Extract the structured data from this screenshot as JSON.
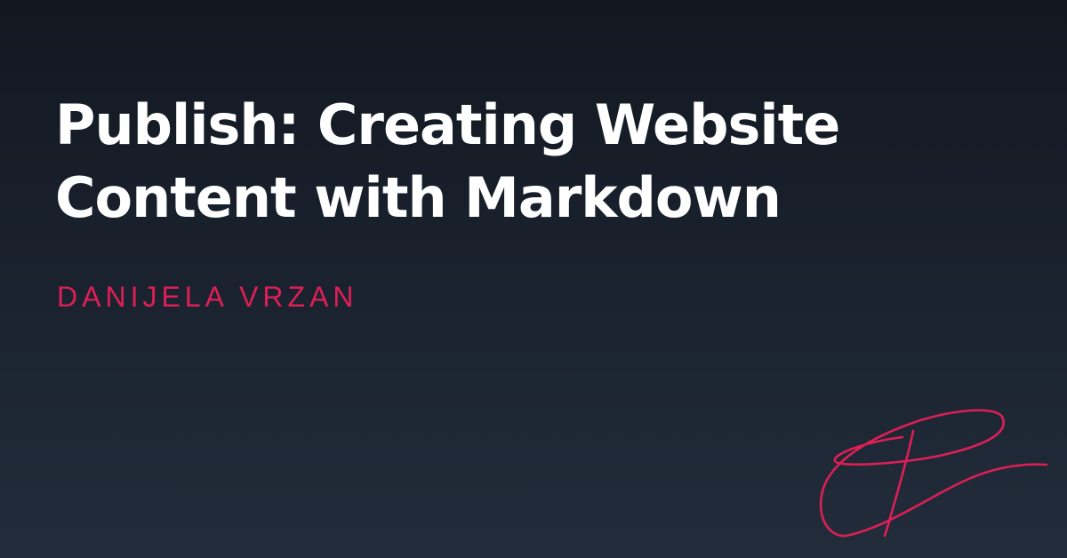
{
  "card": {
    "title_line1": "Publish: Creating Website",
    "title_line2": "Content with Markdown",
    "author": "DANIJELA VRZAN",
    "logo_icon": "signature-d-icon"
  },
  "colors": {
    "background_top": "#121820",
    "background_bottom": "#222c3a",
    "title": "#ffffff",
    "accent": "#dc1f55"
  }
}
